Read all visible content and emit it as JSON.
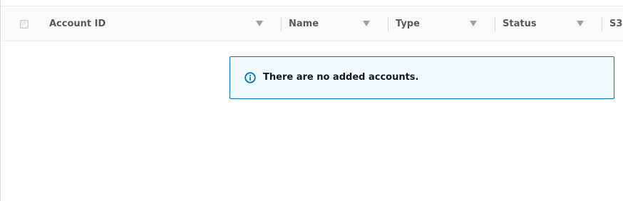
{
  "table": {
    "columns": [
      {
        "label": "Account ID"
      },
      {
        "label": "Name"
      },
      {
        "label": "Type"
      },
      {
        "label": "Status"
      },
      {
        "label": "S3"
      }
    ],
    "empty_message": "There are no added accounts."
  },
  "icons": {
    "sort": "sort-desc-icon",
    "info": "info-icon",
    "select_all": "checkbox-icon"
  },
  "colors": {
    "header_bg": "#fafafa",
    "header_text": "#545b64",
    "sort_arrow": "#95a5a6",
    "alert_border": "#0073bb",
    "alert_bg": "#f1faff"
  }
}
